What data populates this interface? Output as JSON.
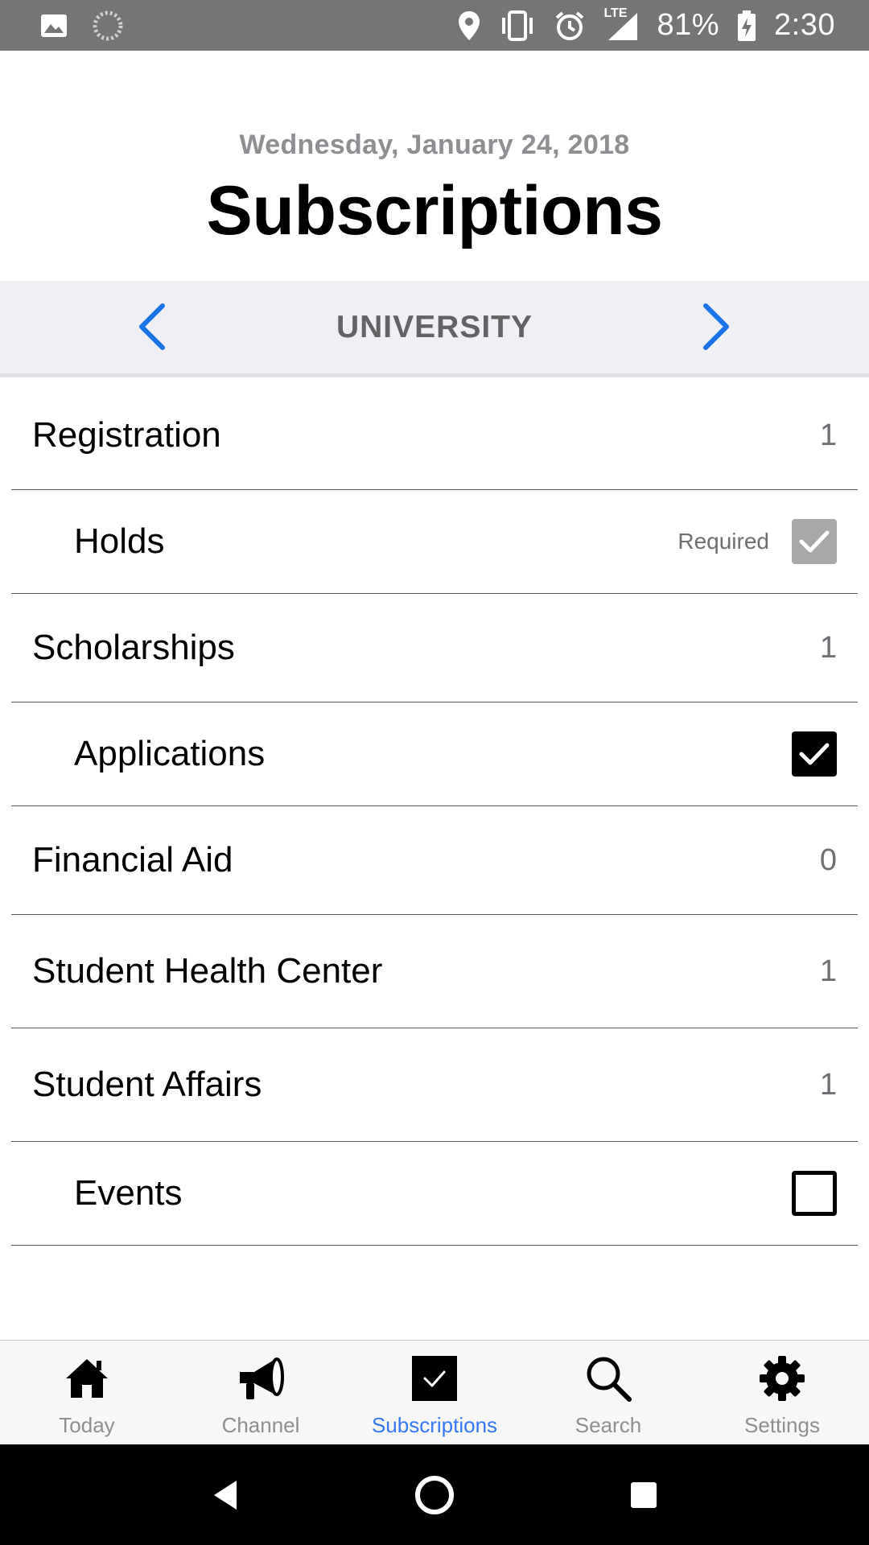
{
  "status_bar": {
    "battery": "81%",
    "time": "2:30",
    "network": "LTE",
    "icons": [
      "image-icon",
      "loading-icon",
      "location-icon",
      "vibrate-icon",
      "alarm-icon",
      "signal-icon",
      "battery-charging-icon"
    ]
  },
  "header": {
    "date": "Wednesday, January 24, 2018",
    "title": "Subscriptions"
  },
  "category": {
    "label": "UNIVERSITY",
    "prev_icon": "chevron-left-icon",
    "next_icon": "chevron-right-icon",
    "accent": "#1a73e8"
  },
  "list": {
    "rows": [
      {
        "label": "Registration",
        "count": "1"
      },
      {
        "label": "Holds",
        "note": "Required",
        "state": "checked-disabled"
      },
      {
        "label": "Scholarships",
        "count": "1"
      },
      {
        "label": "Applications",
        "state": "checked"
      },
      {
        "label": "Financial Aid",
        "count": "0"
      },
      {
        "label": "Student Health Center",
        "count": "1"
      },
      {
        "label": "Student Affairs",
        "count": "1"
      },
      {
        "label": "Events",
        "state": "unchecked"
      }
    ]
  },
  "tabs": [
    {
      "label": "Today",
      "icon": "home-icon"
    },
    {
      "label": "Channel",
      "icon": "megaphone-icon"
    },
    {
      "label": "Subscriptions",
      "icon": "checkbox-icon",
      "active": true
    },
    {
      "label": "Search",
      "icon": "search-icon"
    },
    {
      "label": "Settings",
      "icon": "gear-icon"
    }
  ],
  "colors": {
    "active_tab": "#3478f6",
    "inactive_tab": "#8e8e93",
    "status_bar": "#757575"
  }
}
